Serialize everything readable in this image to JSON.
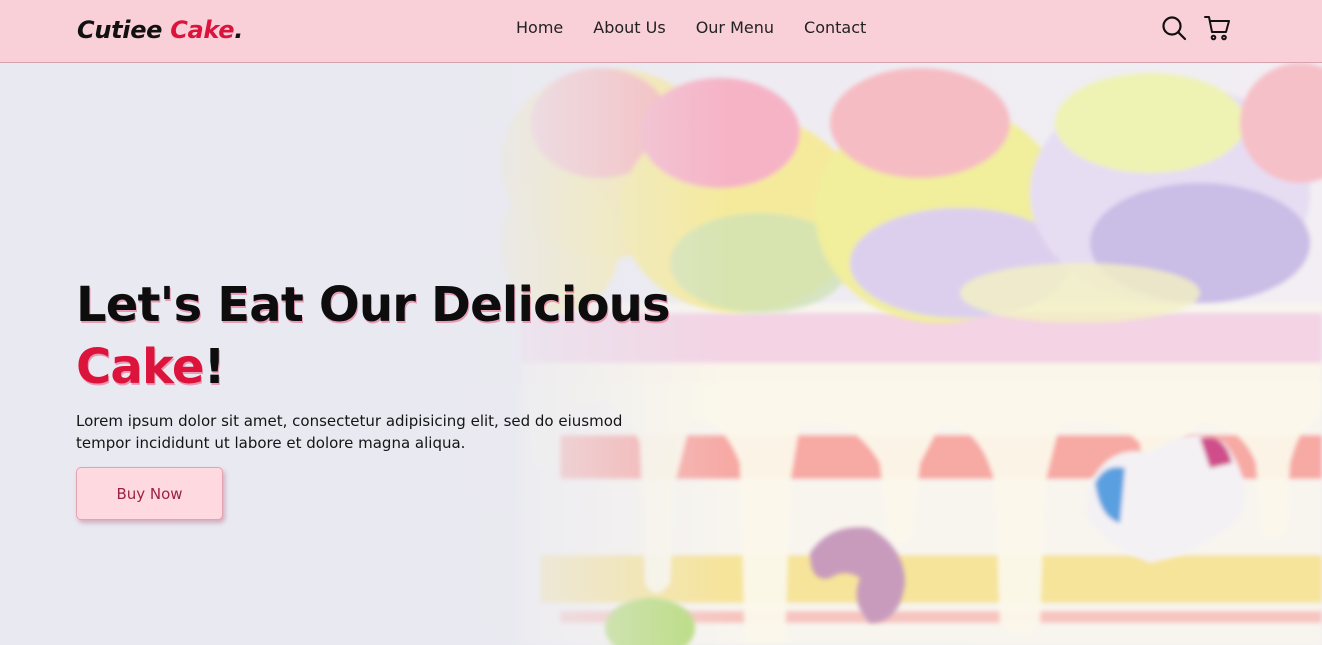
{
  "brand": {
    "name": "Cutiee",
    "accent_word": "Cake",
    "suffix": "."
  },
  "nav": {
    "items": [
      {
        "label": "Home"
      },
      {
        "label": "About Us"
      },
      {
        "label": "Our Menu"
      },
      {
        "label": "Contact"
      }
    ]
  },
  "header_icons": {
    "search": "search-icon",
    "cart": "cart-icon"
  },
  "hero": {
    "title_line1": "Let's Eat Our Delicious",
    "title_accent": "Cake",
    "title_end": "!",
    "description": "Lorem ipsum dolor sit amet, consectetur adipisicing elit, sed do eiusmod tempor incididunt ut labore et dolore magna aliqua.",
    "button_label": "Buy Now"
  },
  "colors": {
    "header_bg": "#facdd6",
    "accent": "#dc143c",
    "button_bg": "#ffd9e0",
    "text": "#111111"
  }
}
